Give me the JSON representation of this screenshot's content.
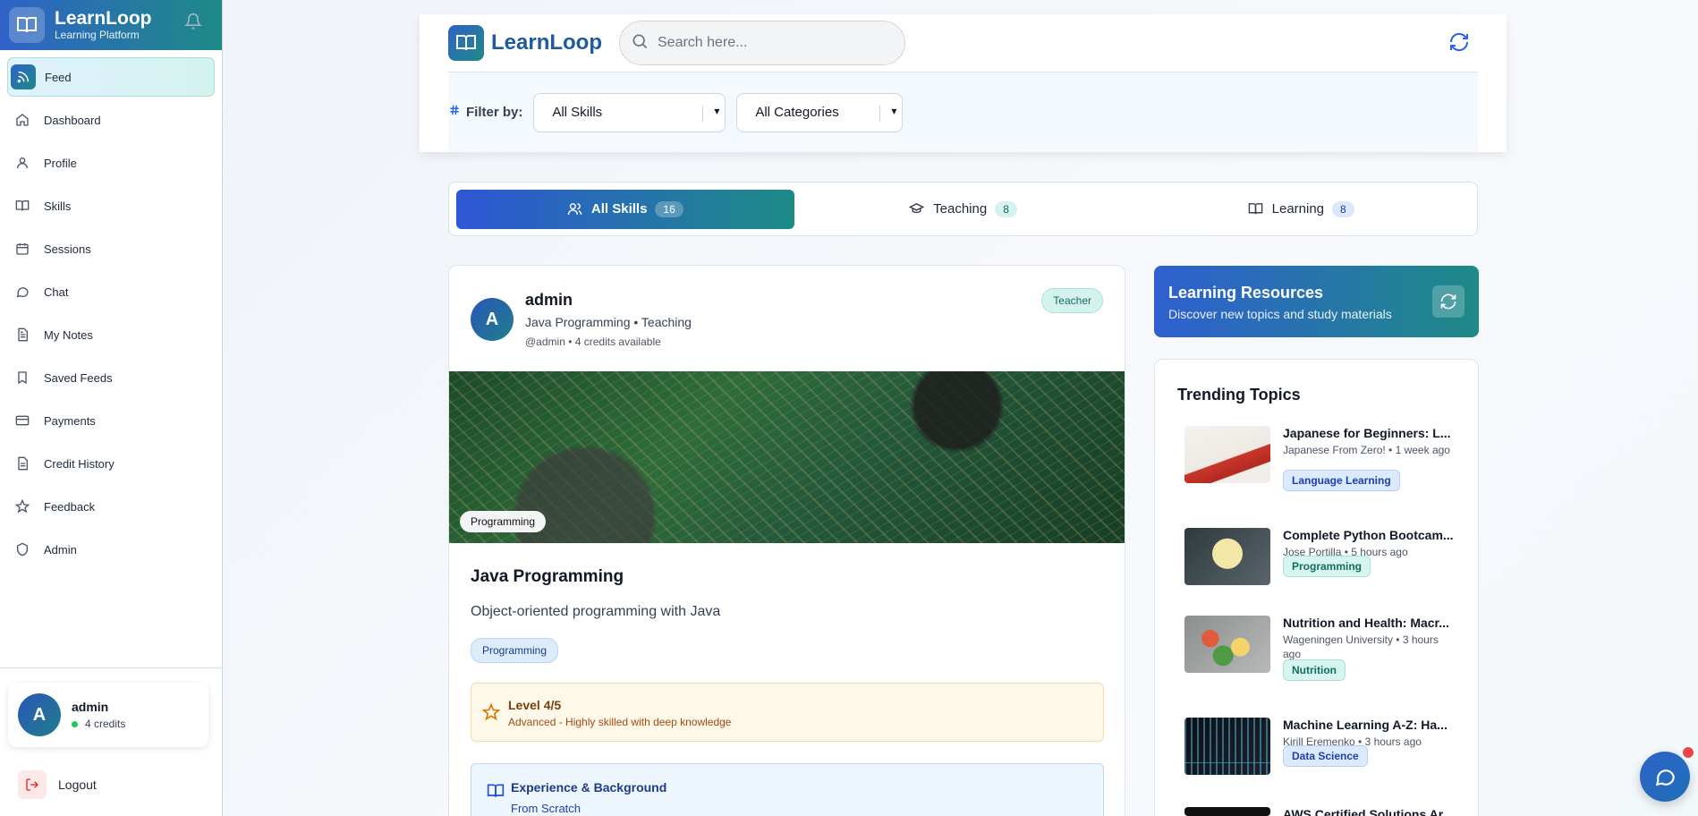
{
  "sidebar": {
    "brand": "LearnLoop",
    "tagline": "Learning Platform",
    "items": [
      {
        "label": "Feed",
        "icon": "rss-icon",
        "active": true
      },
      {
        "label": "Dashboard",
        "icon": "home-icon"
      },
      {
        "label": "Profile",
        "icon": "user-icon"
      },
      {
        "label": "Skills",
        "icon": "book-icon"
      },
      {
        "label": "Sessions",
        "icon": "calendar-icon"
      },
      {
        "label": "Chat",
        "icon": "chat-icon"
      },
      {
        "label": "My Notes",
        "icon": "notes-icon"
      },
      {
        "label": "Saved Feeds",
        "icon": "bookmark-icon"
      },
      {
        "label": "Payments",
        "icon": "card-icon"
      },
      {
        "label": "Credit History",
        "icon": "document-icon"
      },
      {
        "label": "Feedback",
        "icon": "star-icon"
      },
      {
        "label": "Admin",
        "icon": "shield-icon"
      }
    ],
    "user": {
      "initial": "A",
      "name": "admin",
      "credits": "4 credits"
    },
    "logout": "Logout"
  },
  "header": {
    "brand": "LearnLoop",
    "search_placeholder": "Search here...",
    "filter_label": "Filter by:",
    "skill_filter": "All Skills",
    "category_filter": "All Categories"
  },
  "tabs": [
    {
      "label": "All Skills",
      "count": "16",
      "active": true
    },
    {
      "label": "Teaching",
      "count": "8"
    },
    {
      "label": "Learning",
      "count": "8"
    }
  ],
  "post": {
    "initial": "A",
    "author": "admin",
    "subtitle": "Java Programming • Teaching",
    "meta": "@admin • 4 credits available",
    "role_badge": "Teacher",
    "image_tag": "Programming",
    "title": "Java Programming",
    "description": "Object-oriented programming with Java",
    "category": "Programming",
    "level_title": "Level 4/5",
    "level_desc": "Advanced - Highly skilled with deep knowledge",
    "experience_title": "Experience & Background",
    "experience_value": "From Scratch"
  },
  "resources": {
    "title": "Learning Resources",
    "subtitle": "Discover new topics and study materials"
  },
  "trending": {
    "title": "Trending Topics",
    "topics": [
      {
        "title": "Japanese for Beginners: L...",
        "meta": "Japanese From Zero! • 1 week ago",
        "tag": "Language Learning"
      },
      {
        "title": "Complete Python Bootcam...",
        "meta": "Jose Portilla • 5 hours ago",
        "tag": "Programming"
      },
      {
        "title": "Nutrition and Health: Macr...",
        "meta": "Wageningen University • 3 hours ago",
        "tag": "Nutrition"
      },
      {
        "title": "Machine Learning A-Z: Ha...",
        "meta": "Kirill Eremenko • 3 hours ago",
        "tag": "Data Science"
      },
      {
        "title": "AWS Certified Solutions Ar...",
        "meta": "",
        "tag": ""
      }
    ]
  },
  "colors": {
    "accent_blue": "#2f62c8",
    "accent_teal": "#1e8a86"
  }
}
